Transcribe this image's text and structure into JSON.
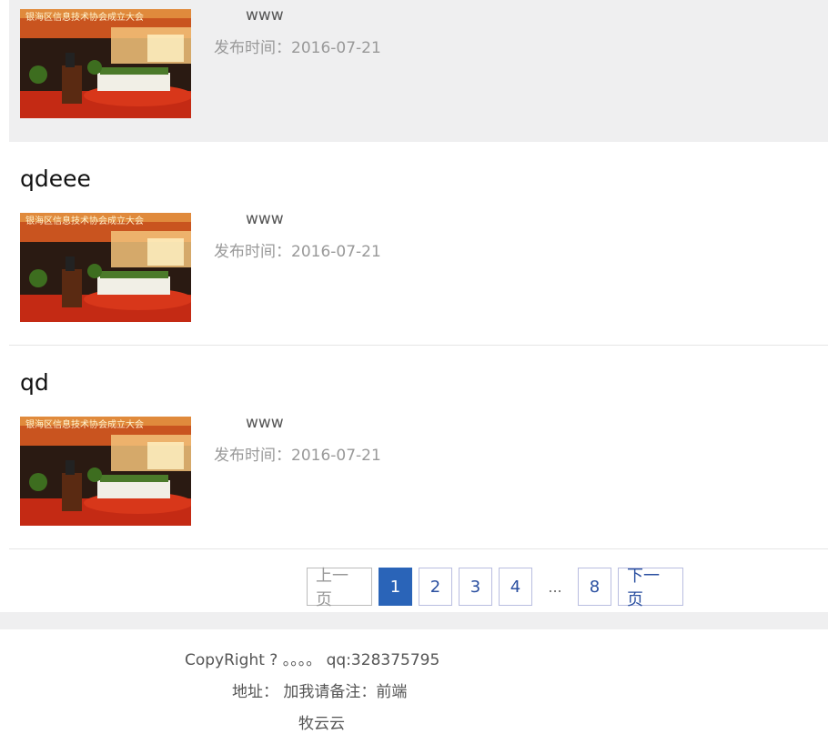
{
  "articles": [
    {
      "title": "",
      "excerpt": "www",
      "date": "发布时间：2016-07-21"
    },
    {
      "title": "qdeee",
      "excerpt": "www",
      "date": "发布时间：2016-07-21"
    },
    {
      "title": "qd",
      "excerpt": "www",
      "date": "发布时间：2016-07-21"
    }
  ],
  "thumbnail": {
    "banner_text": "银海区信息技术协会成立大会"
  },
  "pagination": {
    "prev_label": "上一页",
    "pages": [
      "1",
      "2",
      "3",
      "4"
    ],
    "ellipsis": "...",
    "last_page": "8",
    "next_label": "下一页",
    "current": "1"
  },
  "footer": {
    "copyright": "CopyRight ? 。。。。 qq:328375795",
    "address": "地址： 加我请备注：前端",
    "site_name": "牧云云"
  },
  "colors": {
    "highlight_bg": "#efeff0",
    "active_page": "#2a64b8",
    "link": "#2a4fa0"
  }
}
